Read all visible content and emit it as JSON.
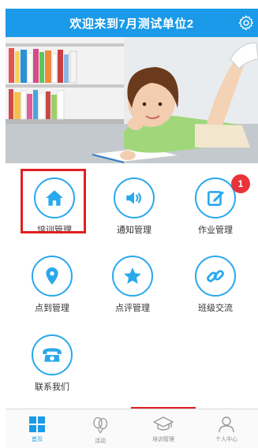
{
  "header": {
    "title": "欢迎来到7月测试单位2"
  },
  "grid": [
    {
      "label": "培训管理",
      "icon": "home-icon"
    },
    {
      "label": "通知管理",
      "icon": "speaker-icon"
    },
    {
      "label": "作业管理",
      "icon": "edit-icon"
    },
    {
      "label": "点到管理",
      "icon": "location-pin-icon"
    },
    {
      "label": "点评管理",
      "icon": "star-icon"
    },
    {
      "label": "班级交流",
      "icon": "link-icon"
    },
    {
      "label": "联系我们",
      "icon": "telephone-icon"
    }
  ],
  "badge": {
    "homework_count": "1"
  },
  "tabbar": [
    {
      "label": "首页",
      "icon": "grid-icon"
    },
    {
      "label": "活动",
      "icon": "balloons-icon"
    },
    {
      "label": "培训管理",
      "icon": "graduation-cap-icon"
    },
    {
      "label": "个人中心",
      "icon": "person-icon"
    }
  ],
  "colors": {
    "primary": "#1a9ae8",
    "icon_blue": "#29a8ec",
    "highlight_red": "#e02020",
    "badge_red": "#e8333a"
  }
}
